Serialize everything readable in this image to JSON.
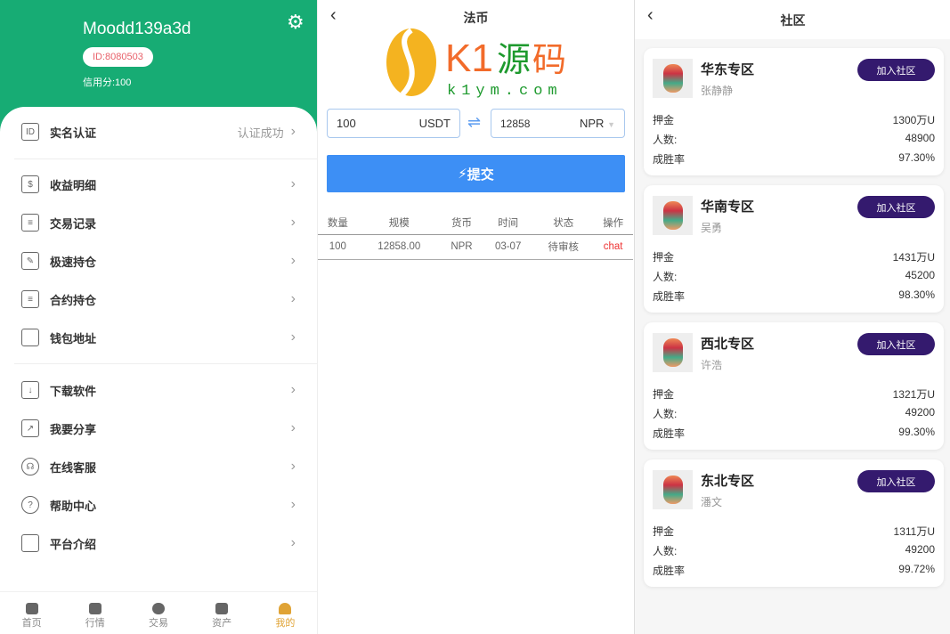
{
  "profile": {
    "username": "Moodd139a3d",
    "id": "ID:8080503",
    "credit": "信用分:100"
  },
  "menu": [
    {
      "label": "实名认证",
      "value": "认证成功",
      "icon": "id-card-icon"
    },
    {
      "label": "收益明细",
      "icon": "receipt-icon"
    },
    {
      "label": "交易记录",
      "icon": "clipboard-icon"
    },
    {
      "label": "极速持仓",
      "icon": "edit-doc-icon"
    },
    {
      "label": "合约持仓",
      "icon": "doc-icon"
    },
    {
      "label": "钱包地址",
      "icon": "wallet-icon"
    },
    {
      "label": "下载软件",
      "icon": "download-icon"
    },
    {
      "label": "我要分享",
      "icon": "share-icon"
    },
    {
      "label": "在线客服",
      "icon": "headset-icon"
    },
    {
      "label": "帮助中心",
      "icon": "help-icon"
    },
    {
      "label": "平台介绍",
      "icon": "monitor-icon"
    }
  ],
  "nav": [
    "首页",
    "行情",
    "交易",
    "资产",
    "我的"
  ],
  "fiat": {
    "title": "法币",
    "amount": "100",
    "from": "USDT",
    "converted": "12858",
    "to": "NPR",
    "submit": "提交",
    "headers": [
      "数量",
      "规模",
      "货币",
      "时间",
      "状态",
      "操作"
    ],
    "rows": [
      [
        "100",
        "12858.00",
        "NPR",
        "03-07",
        "待审核",
        "chat"
      ]
    ]
  },
  "watermark": {
    "brand": "K1源码",
    "url": "k1ym.com"
  },
  "community": {
    "title": "社区",
    "join": "加入社区",
    "labels": {
      "deposit": "押金",
      "members": "人数:",
      "winrate": "成胜率"
    },
    "cards": [
      {
        "name": "华东专区",
        "owner": "张静静",
        "deposit": "1300万U",
        "members": "48900",
        "winrate": "97.30%"
      },
      {
        "name": "华南专区",
        "owner": "吴勇",
        "deposit": "1431万U",
        "members": "45200",
        "winrate": "98.30%"
      },
      {
        "name": "西北专区",
        "owner": "许浩",
        "deposit": "1321万U",
        "members": "49200",
        "winrate": "99.30%"
      },
      {
        "name": "东北专区",
        "owner": "潘文",
        "deposit": "1311万U",
        "members": "49200",
        "winrate": "99.72%"
      }
    ]
  },
  "colors": {
    "green": "#17ac74",
    "blue": "#3d8ff5",
    "purple": "#341a6e",
    "navActive": "#e0a335"
  }
}
